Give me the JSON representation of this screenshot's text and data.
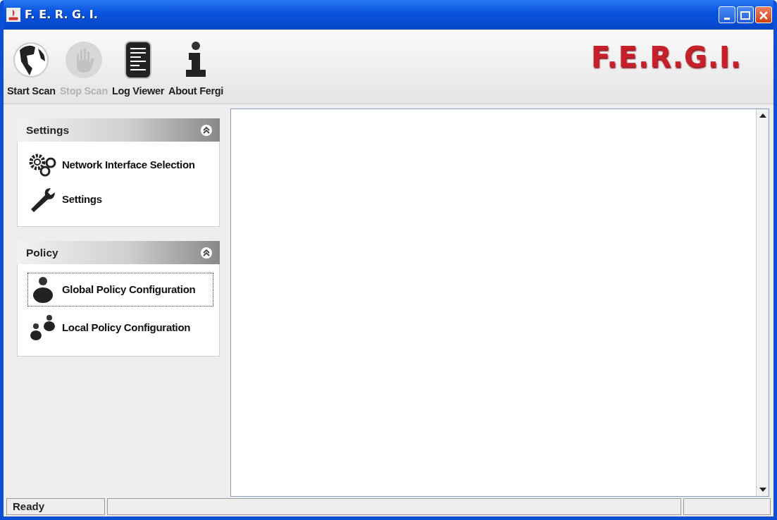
{
  "window": {
    "title": "F. E. R. G. I."
  },
  "toolbar": [
    {
      "label": "Start Scan",
      "disabled": false
    },
    {
      "label": "Stop Scan",
      "disabled": true
    },
    {
      "label": "Log Viewer",
      "disabled": false
    },
    {
      "label": "About Fergi",
      "disabled": false
    }
  ],
  "logo": "F.E.R.G.I.",
  "sidebar": {
    "panels": [
      {
        "title": "Settings",
        "expanded": true,
        "items": [
          {
            "label": "Network Interface Selection",
            "selected": false
          },
          {
            "label": "Settings",
            "selected": false
          }
        ]
      },
      {
        "title": "Policy",
        "expanded": true,
        "items": [
          {
            "label": "Global Policy Configuration",
            "selected": true
          },
          {
            "label": "Local Policy Configuration",
            "selected": false
          }
        ]
      }
    ]
  },
  "status_bar": {
    "text": "Ready"
  }
}
